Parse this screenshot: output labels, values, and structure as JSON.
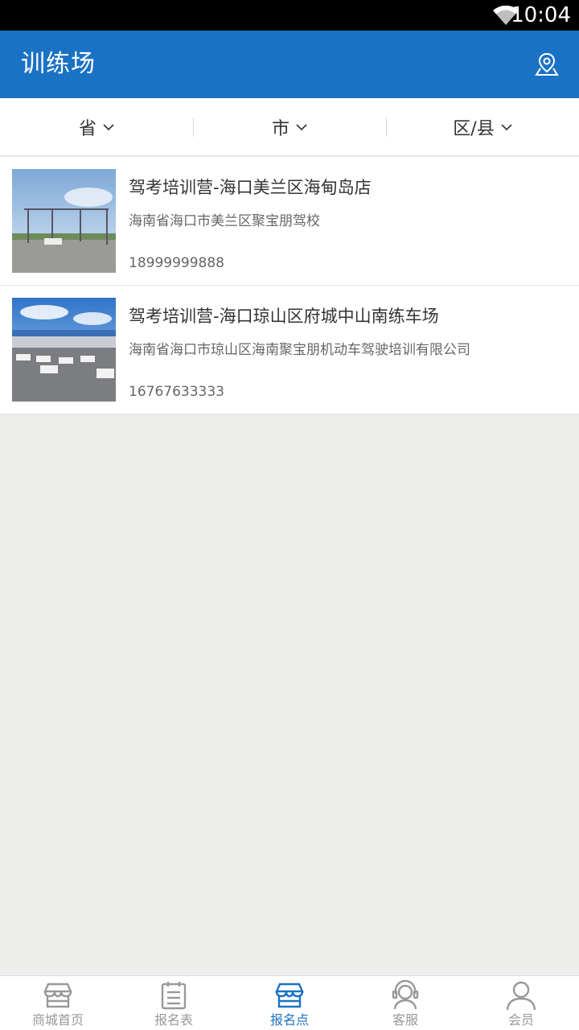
{
  "status": {
    "time": "10:04"
  },
  "header": {
    "title": "训练场",
    "location_icon": "map-pin-icon"
  },
  "filters": [
    {
      "label": "省"
    },
    {
      "label": "市"
    },
    {
      "label": "区/县"
    }
  ],
  "items": [
    {
      "name": "驾考培训营-海口美兰区海甸岛店",
      "address": "海南省海口市美兰区聚宝朋驾校",
      "phone": "18999999888"
    },
    {
      "name": "驾考培训营-海口琼山区府城中山南练车场",
      "address": "海南省海口市琼山区海南聚宝朋机动车驾驶培训有限公司",
      "phone": "16767633333"
    }
  ],
  "tabs": [
    {
      "label": "商城首页",
      "icon": "store-icon"
    },
    {
      "label": "报名表",
      "icon": "clipboard-icon"
    },
    {
      "label": "报名点",
      "icon": "store-icon",
      "active": true
    },
    {
      "label": "客服",
      "icon": "headset-icon"
    },
    {
      "label": "会员",
      "icon": "user-icon"
    }
  ],
  "colors": {
    "primary": "#1a72c4",
    "background": "#ededeb",
    "inactive": "#999999"
  }
}
